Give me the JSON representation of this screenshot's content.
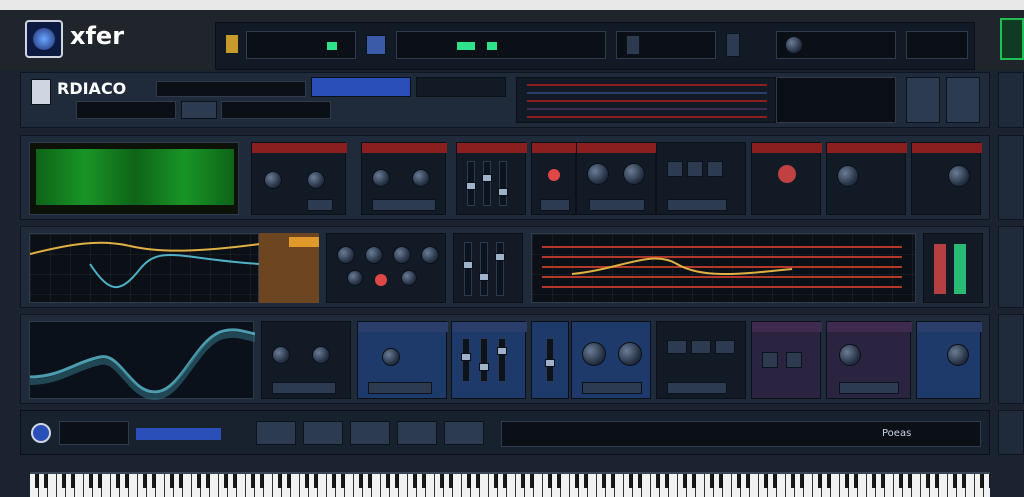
{
  "app": {
    "logo_text": "xfer",
    "logo_subtitle": "",
    "header_left_title": "RDIACO",
    "header_left_badge": "",
    "header_blue_display": "",
    "header_meter_text": ""
  },
  "top_bar": {
    "segment_1": "",
    "segment_2": "",
    "segment_3": "",
    "segment_4": "",
    "segment_5": ""
  },
  "rows": {
    "row1": {
      "panel_a_title": "",
      "panel_b_title": "",
      "panel_c_title": "",
      "panel_d_title": "",
      "panel_e_title": "",
      "panel_f_title": "",
      "panel_g_title": ""
    },
    "row2": {
      "panel_a_title": "",
      "panel_b_title": "",
      "panel_c_title": "",
      "panel_d_title": "",
      "panel_e_title": ""
    },
    "row3": {
      "panel_a_title": "",
      "panel_b_title": "",
      "panel_c_title": "",
      "panel_d_title": "",
      "panel_e_title": "",
      "panel_f_title": "",
      "panel_g_title": ""
    }
  },
  "bottom_bar": {
    "display_text": "",
    "right_text": "Poeas"
  },
  "colors": {
    "accent_blue": "#2b4fb8",
    "accent_red": "#8b1e1e",
    "accent_green": "#1fbf55",
    "panel_bg": "#1f2a3a"
  },
  "icons": {
    "logo": "xfer-logo-icon",
    "bottom_circle": "circle-icon"
  }
}
